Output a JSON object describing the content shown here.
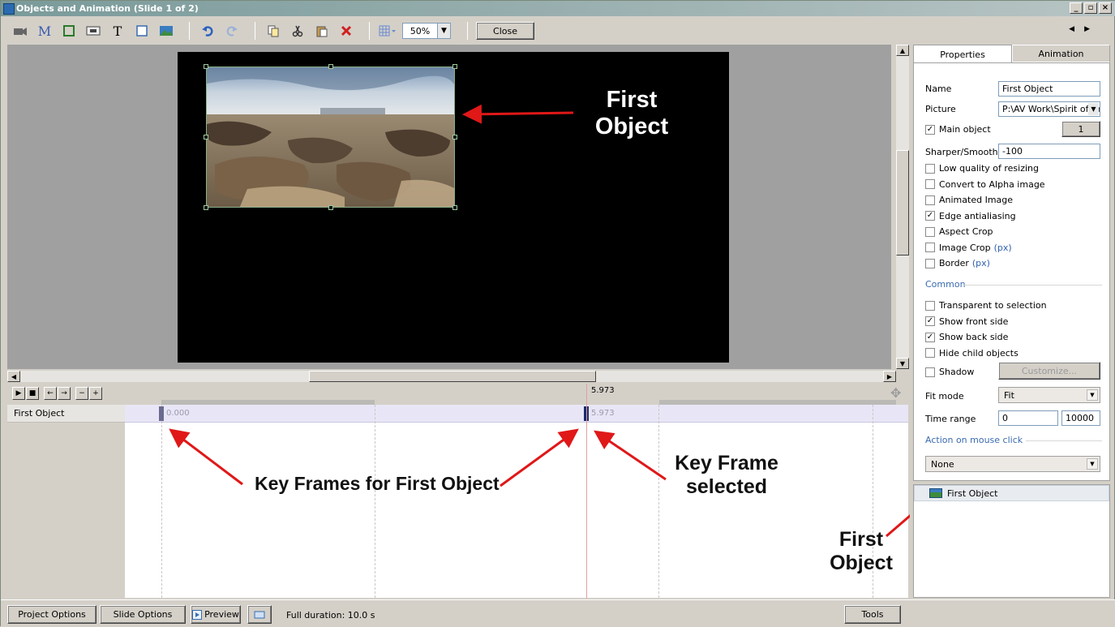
{
  "window": {
    "title": "Objects and Animation (Slide 1 of 2)"
  },
  "toolbar": {
    "icons": [
      "camera-icon",
      "mask-icon",
      "frame-icon",
      "button-icon",
      "text-icon",
      "rectangle-icon",
      "image-icon",
      "undo-icon",
      "redo-icon",
      "copy-icon",
      "cut-icon",
      "paste-icon",
      "delete-icon",
      "grid-icon"
    ],
    "text_glyph": "T",
    "mask_glyph": "M",
    "zoom": "50%",
    "close_label": "Close"
  },
  "annotations": {
    "stage": "First\nObject",
    "keyframes": "Key Frames for First Object",
    "selected": "Key Frame\nselected",
    "list": "First\nObject"
  },
  "timeline": {
    "ruler_label": "5.973",
    "track_name": "First Object",
    "kf1_label": "0.000",
    "kf2_label": "5.973"
  },
  "panel": {
    "tabs": [
      "Properties",
      "Animation"
    ],
    "name_label": "Name",
    "name_value": "First Object",
    "picture_label": "Picture",
    "picture_value": "P:\\AV Work\\Spirit of the",
    "main_object": "Main object",
    "main_object_num": "1",
    "sharper_label": "Sharper/Smoother",
    "sharper_value": "-100",
    "checks": [
      {
        "label": "Low quality of resizing",
        "checked": false
      },
      {
        "label": "Convert to Alpha image",
        "checked": false
      },
      {
        "label": "Animated Image",
        "checked": false
      },
      {
        "label": "Edge antialiasing",
        "checked": true
      },
      {
        "label": "Aspect Crop",
        "checked": false
      },
      {
        "label": "Image Crop",
        "checked": false,
        "suffix": "(px)"
      },
      {
        "label": "Border",
        "checked": false,
        "suffix": "(px)"
      }
    ],
    "common_header": "Common",
    "common_checks": [
      {
        "label": "Transparent to selection",
        "checked": false
      },
      {
        "label": "Show front side",
        "checked": true
      },
      {
        "label": "Show back side",
        "checked": true
      },
      {
        "label": "Hide child objects",
        "checked": false
      }
    ],
    "shadow_label": "Shadow",
    "customize_label": "Customize...",
    "fitmode_label": "Fit mode",
    "fitmode_value": "Fit",
    "timerange_label": "Time range",
    "timerange_from": "0",
    "timerange_dash": "–",
    "timerange_to": "10000",
    "action_header": "Action on mouse click",
    "action_value": "None",
    "object_list_item": "First Object"
  },
  "bottom": {
    "project_options": "Project Options",
    "slide_options": "Slide Options",
    "preview": "Preview",
    "full_duration": "Full duration: 10.0 s",
    "tools": "Tools"
  },
  "colors": {
    "arrow": "#e01818",
    "stage": "#000000",
    "keyframe_selected": "#1a2a6a"
  }
}
